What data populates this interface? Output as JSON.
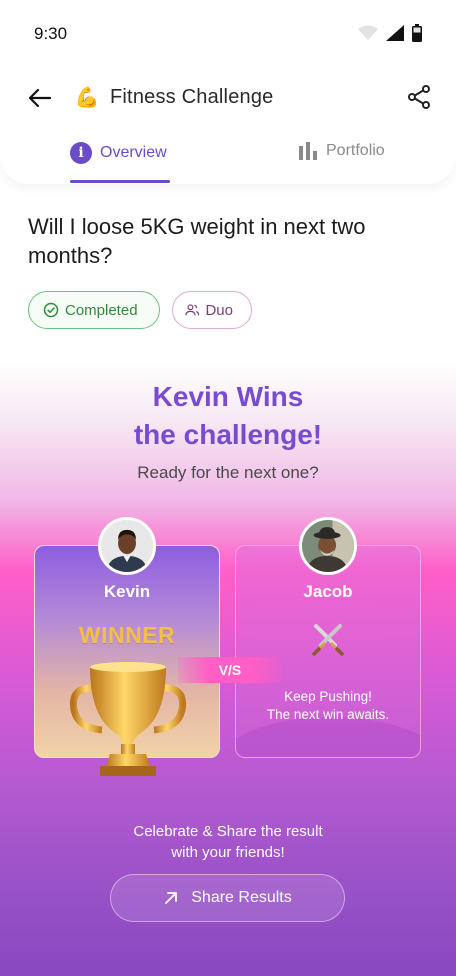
{
  "status_bar": {
    "time": "9:30"
  },
  "header": {
    "title": "Fitness Challenge",
    "emoji": "💪",
    "tabs": [
      {
        "label": "Overview",
        "icon": "info-icon",
        "active": true
      },
      {
        "label": "Portfolio",
        "icon": "bar-chart-icon",
        "active": false
      }
    ]
  },
  "challenge": {
    "question": "Will I loose 5KG weight in next two months?",
    "status_chip": "Completed",
    "type_chip": "Duo"
  },
  "result": {
    "headline_line1": "Kevin Wins",
    "headline_line2": "the challenge!",
    "subtext": "Ready for the next one?",
    "vs_label": "V/S",
    "winner": {
      "name": "Kevin",
      "badge": "WINNER"
    },
    "opponent": {
      "name": "Jacob",
      "message_line1": "Keep Pushing!",
      "message_line2": "The next win awaits."
    }
  },
  "footer": {
    "celebrate_line1": "Celebrate & Share the result",
    "celebrate_line2": "with your friends!",
    "share_button": "Share Results"
  },
  "colors": {
    "accent": "#6b4bc7",
    "headline": "#7a4bd0",
    "success": "#2e8b3d",
    "winner_gold": "#f2c04a",
    "vs_pink": "#ff5ec5"
  }
}
